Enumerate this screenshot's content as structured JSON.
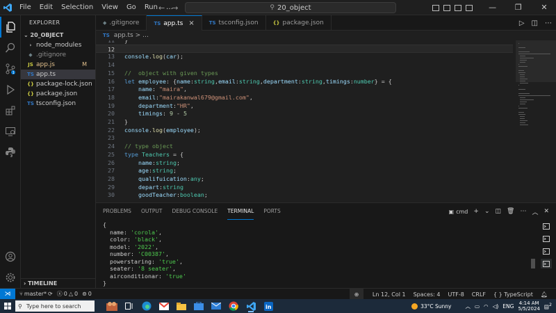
{
  "titlebar": {
    "menu": [
      "File",
      "Edit",
      "Selection",
      "View",
      "Go",
      "Run",
      "…"
    ],
    "search_text": "20_object",
    "window_controls": [
      "—",
      "❐",
      "✕"
    ]
  },
  "sidebar": {
    "header": "EXPLORER",
    "folder": "20_OBJECT",
    "items": [
      {
        "icon": "›",
        "label": "node_modules",
        "color": "#cccccc"
      },
      {
        "icon": "◆",
        "label": ".gitignore",
        "color": "#8f8f8f"
      },
      {
        "icon": "JS",
        "label": "app.js",
        "color": "#e2c08d",
        "badge": "M"
      },
      {
        "icon": "TS",
        "label": "app.ts",
        "color": "#cccccc"
      },
      {
        "icon": "{}",
        "label": "package-lock.json",
        "color": "#cccccc"
      },
      {
        "icon": "{}",
        "label": "package.json",
        "color": "#cccccc"
      },
      {
        "icon": "TS",
        "label": "tsconfig.json",
        "color": "#cccccc"
      }
    ],
    "timeline": "TIMELINE"
  },
  "tabs": [
    {
      "icon": "◆",
      "label": ".gitignore",
      "active": false
    },
    {
      "icon": "TS",
      "label": "app.ts",
      "active": true,
      "close": "×"
    },
    {
      "icon": "TS",
      "label": "tsconfig.json",
      "active": false
    },
    {
      "icon": "{}",
      "label": "package.json",
      "active": false
    }
  ],
  "breadcrumbs": {
    "file": "app.ts",
    "sep": "> …"
  },
  "editor": {
    "lines": [
      {
        "n": "11",
        "text": "}"
      },
      {
        "n": "12",
        "text": ""
      },
      {
        "n": "13",
        "text": "console.log(car);"
      },
      {
        "n": "14",
        "text": ""
      },
      {
        "n": "15",
        "text": "//  object with given types"
      },
      {
        "n": "16",
        "text": "let employee: {name:string,email:string,department:string,timings:number} = {"
      },
      {
        "n": "17",
        "text": "    name: \"maira\","
      },
      {
        "n": "18",
        "text": "    email:\"mairakanwal679@gmail.com\","
      },
      {
        "n": "19",
        "text": "    department:\"HR\","
      },
      {
        "n": "20",
        "text": "    timings: 9 - 5"
      },
      {
        "n": "21",
        "text": "}"
      },
      {
        "n": "22",
        "text": "console.log(employee);"
      },
      {
        "n": "23",
        "text": ""
      },
      {
        "n": "24",
        "text": "// type object"
      },
      {
        "n": "25",
        "text": "type Teachers = {"
      },
      {
        "n": "26",
        "text": "    name:string;"
      },
      {
        "n": "27",
        "text": "    age:string;"
      },
      {
        "n": "28",
        "text": "    qualifuication:any;"
      },
      {
        "n": "29",
        "text": "    depart:string"
      },
      {
        "n": "30",
        "text": "    goodTeacher:boolean;"
      }
    ]
  },
  "panel": {
    "tabs": [
      "PROBLEMS",
      "OUTPUT",
      "DEBUG CONSOLE",
      "TERMINAL",
      "PORTS"
    ],
    "active_tab": "TERMINAL",
    "terminal_name": "cmd",
    "terminal_lines": [
      "{",
      "  name: 'corola',",
      "  color: 'black',",
      "  model: '2022',",
      "  number: 'C00387',",
      "  powerstaring: 'true',",
      "  seater: '8 seater',",
      "  airconditionar: 'true'",
      "}"
    ]
  },
  "statusbar": {
    "branch": "master*",
    "errors": "0",
    "warnings": "0",
    "info": "0",
    "position": "Ln 12, Col 1",
    "spaces": "Spaces: 4",
    "encoding": "UTF-8",
    "eol": "CRLF",
    "language": "{ } TypeScript"
  },
  "taskbar": {
    "search_placeholder": "Type here to search",
    "weather": "33°C  Sunny",
    "lang": "ENG",
    "time": "4:14 AM",
    "date": "5/5/2024",
    "notif_count": "2"
  },
  "colors": {
    "accent": "#0078d4",
    "keyword": "#569cd6",
    "string": "#ce9178",
    "type": "#4ec9b0",
    "comment": "#6a9955",
    "property": "#9cdcfe",
    "function": "#dcdcaa",
    "number": "#b5cea8"
  }
}
